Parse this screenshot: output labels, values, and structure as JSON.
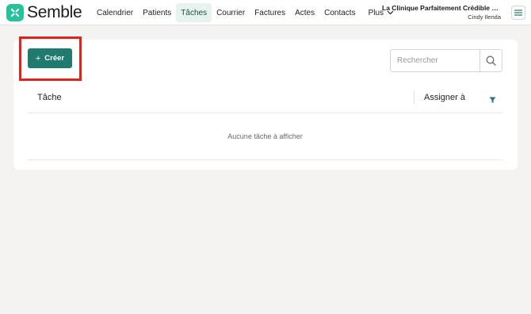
{
  "brand": {
    "name": "Semble"
  },
  "nav": {
    "items": [
      {
        "label": "Calendrier"
      },
      {
        "label": "Patients"
      },
      {
        "label": "Tâches"
      },
      {
        "label": "Courrier"
      },
      {
        "label": "Factures"
      },
      {
        "label": "Actes"
      },
      {
        "label": "Contacts"
      },
      {
        "label": "Plus"
      }
    ],
    "active": "Tâches"
  },
  "account": {
    "clinic_name": "La Clinique Parfaitement Crédible d...",
    "user_name": "Cindy Ilenda"
  },
  "toolbar": {
    "create_label": "Créer",
    "search_placeholder": "Rechercher"
  },
  "table": {
    "columns": [
      "Tâche",
      "Assigner à"
    ],
    "empty_message": "Aucune tâche à afficher"
  },
  "colors": {
    "accent": "#1f7a70",
    "brand": "#27c29a",
    "highlight": "#e0241b",
    "active_tab_bg": "#e6f3ef"
  }
}
